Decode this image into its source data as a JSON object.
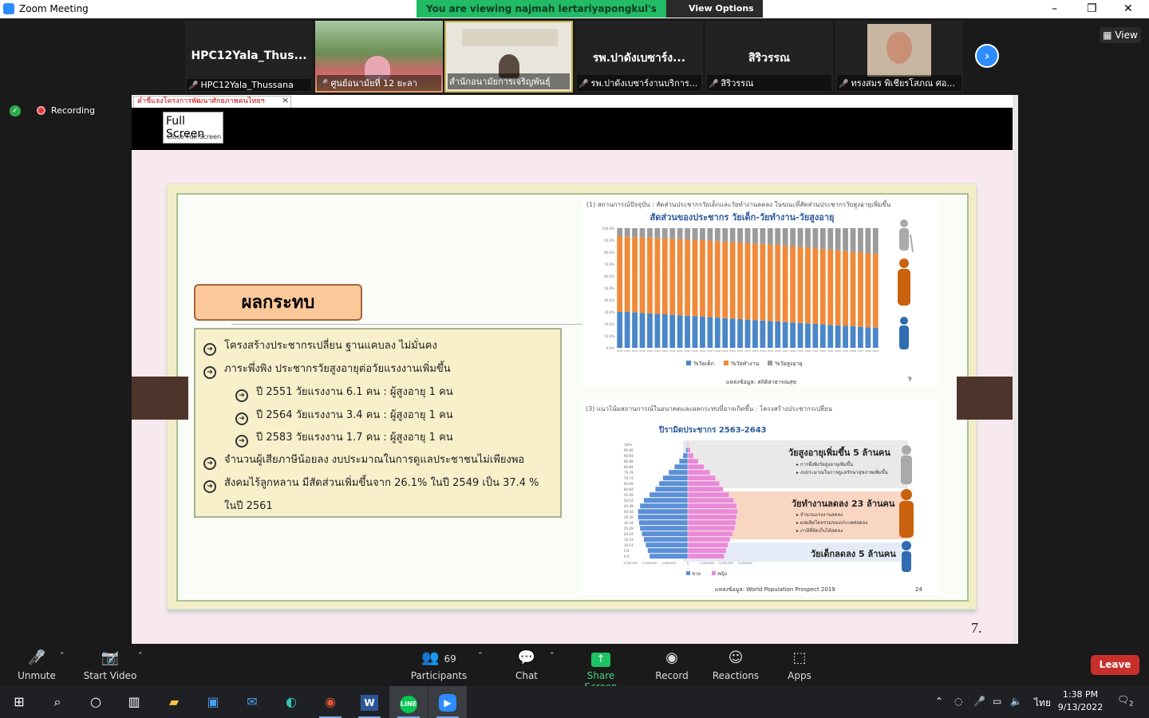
{
  "window": {
    "title": "Zoom Meeting",
    "minimize": "–",
    "restore": "❐",
    "close": "✕"
  },
  "banner": {
    "text": "You are viewing najmah lertariyapongkul's screen",
    "view_options": "View Options"
  },
  "participants_strip": [
    {
      "name": "HPC12Yala_Thus...",
      "label": "HPC12Yala_Thussana",
      "muted": true
    },
    {
      "name": "",
      "label": "ศูนย์อนามัยที่ 12 ยะลา",
      "muted": true
    },
    {
      "name": "",
      "label": "สำนักอนามัยการเจริญพันธุ์",
      "muted": false
    },
    {
      "name": "รพ.ปาดังเบซาร์ง...",
      "label": "รพ.ปาดังเบซาร์งานบริการ...",
      "muted": true
    },
    {
      "name": "สิริวรรณ",
      "label": "สิริวรรณ",
      "muted": true
    },
    {
      "name": "",
      "label": "ทรงสมร พิเชียรโสภณ ศอ...",
      "muted": true
    }
  ],
  "view_button": "View",
  "recording_label": "Recording",
  "browser_tab": {
    "title": "คำชี้แจงโครงการพัฒนาศักยภาพคนไทยฯ",
    "close": "×"
  },
  "fullscreen_tooltip": {
    "title": "Full Screen",
    "subtitle": "Close Full Screen"
  },
  "slide": {
    "heading": "ผลกระทบ",
    "bullets": [
      "โครงสร้างประชากรเปลี่ยน ฐานแคบลง ไม่มั่นคง",
      "ภาระพึ่งพิง ประชากรวัยสูงอายุต่อวัยแรงงานเพิ่มขึ้น",
      "ปี 2551 วัยแรงงาน 6.1 คน : ผู้สูงอายุ 1 คน",
      "ปี 2564 วัยแรงงาน 3.4 คน : ผู้สูงอายุ 1 คน",
      "ปี 2583 วัยแรงงาน 1.7 คน : ผู้สูงอายุ 1 คน",
      "จำนวนผู้เสียภาษีน้อยลง งบประมาณในการดูแลประชาชนไม่เพียงพอ",
      "สังคมไร้ลูกหลาน มีสัดส่วนเพิ่มขึ้นจาก 26.1% ในปี 2549 เป็น 37.4 %",
      "ในปี 2561"
    ],
    "page_number": "7.",
    "chart_caption": "(1) สถานการณ์ปัจจุบัน : สัดส่วนประชากรวัยเด็กและวัยทำงานลดลง ในขณะที่สัดส่วนประชากรวัยสูงอายุเพิ่มขึ้น",
    "chart_title": "สัดส่วนของประชากร วัยเด็ก-วัยทำงาน-วัยสูงอายุ",
    "chart_source": "แหล่งข้อมูล: สถิติสาธารณสุข",
    "chart_page": "9",
    "pyramid_caption": "(3) แนวโน้มสถานการณ์ในอนาคตและผลกระทบที่อาจเกิดขึ้น : โครงสร้างประชากรเปลี่ยน",
    "pyramid_title": "ปิรามิดประชากร 2563-2643",
    "pyramid_bands": [
      {
        "title": "วัยสูงอายุเพิ่มขึ้น 5 ล้านคน",
        "items": [
          "การพึ่งพิงวัยสูงอายุเพิ่มขึ้น",
          "งบประมาณในการดูแลรักษาสุขภาพเพิ่มขึ้น"
        ]
      },
      {
        "title": "วัยทำงานลดลง 23 ล้านคน",
        "items": [
          "จำนวนแรงงานลดลง",
          "ผลผลิตโดยรวมของประเทศลดลง",
          "ภาษีที่จัดเก็บได้ลดลง"
        ]
      },
      {
        "title": "วัยเด็กลดลง 5 ล้านคน",
        "items": []
      }
    ],
    "pyramid_legend": [
      "ชาย",
      "หญิง"
    ],
    "pyramid_source": "แหล่งข้อมูล: World Population Prospect 2019",
    "pyramid_page": "24"
  },
  "chart_data": [
    {
      "type": "bar",
      "title": "สัดส่วนของประชากร วัยเด็ก-วัยทำงาน-วัยสูงอายุ",
      "stacked": true,
      "categories": [
        "2535",
        "2536",
        "2537",
        "2538",
        "2539",
        "2540",
        "2541",
        "2542",
        "2543",
        "2544",
        "2545",
        "2546",
        "2547",
        "2548",
        "2549",
        "2550",
        "2551",
        "2552",
        "2553",
        "2554",
        "2555",
        "2556",
        "2557",
        "2558",
        "2559",
        "2560",
        "2561",
        "2562",
        "2563",
        "2564",
        "2565",
        "2566",
        "2567",
        "2568",
        "2569"
      ],
      "y_ticks": [
        "0.0%",
        "10.0%",
        "20.0%",
        "30.0%",
        "40.0%",
        "50.0%",
        "60.0%",
        "70.0%",
        "80.0%",
        "90.0%",
        "100.0%"
      ],
      "ylim": [
        0,
        100
      ],
      "series": [
        {
          "name": "%วัยเด็ก",
          "color": "#4a86c8",
          "values": [
            30,
            30,
            29.6,
            29.2,
            28.8,
            28.4,
            28,
            27.6,
            27.2,
            26.8,
            26.4,
            26,
            25.6,
            25.2,
            24.8,
            24.4,
            24,
            23.6,
            23.2,
            22.8,
            22.4,
            22,
            21.6,
            21.2,
            20.8,
            20.4,
            20,
            19.6,
            19.2,
            18.8,
            18.4,
            18,
            17.6,
            17.2,
            16.8
          ]
        },
        {
          "name": "%วัยทำงาน",
          "color": "#f08a3a",
          "values": [
            63,
            62.8,
            63,
            63.2,
            63.3,
            63.4,
            63.5,
            63.6,
            63.7,
            63.8,
            63.9,
            64,
            64,
            64,
            64,
            64,
            64,
            64,
            64,
            64,
            64,
            64,
            64,
            63.8,
            63.6,
            63.4,
            63.2,
            63,
            62.8,
            62.6,
            62.4,
            62.2,
            62,
            61.8,
            61.6
          ]
        },
        {
          "name": "%วัยสูงอายุ",
          "color": "#9b9b9b",
          "values": [
            7,
            7.2,
            7.4,
            7.6,
            7.9,
            8.2,
            8.5,
            8.8,
            9.1,
            9.4,
            9.7,
            10,
            10.4,
            10.8,
            11.2,
            11.6,
            12,
            12.4,
            12.8,
            13.2,
            13.6,
            14,
            14.4,
            15,
            15.6,
            16.2,
            16.8,
            17.4,
            18,
            18.6,
            19.2,
            19.8,
            20.4,
            21,
            21.6
          ]
        }
      ],
      "legend": "bottom"
    },
    {
      "type": "bar",
      "title": "ปิรามิดประชากร 2563-2643",
      "orientation": "horizontal",
      "categories": [
        "0-4",
        "5-9",
        "10-14",
        "15-19",
        "20-24",
        "25-29",
        "30-34",
        "35-39",
        "40-44",
        "45-49",
        "50-54",
        "55-59",
        "60-64",
        "65-69",
        "70-74",
        "75-79",
        "80-84",
        "85-89",
        "90-94",
        "95-99",
        "100+"
      ],
      "x_ticks": [
        "3,000,000",
        "2,000,000",
        "1,000,000",
        "0",
        "1,000,000",
        "2,000,000",
        "3,000,000"
      ],
      "series": [
        {
          "name": "ชาย",
          "color": "#5b8fd6",
          "values": [
            2000000,
            2100000,
            2200000,
            2300000,
            2400000,
            2500000,
            2550000,
            2600000,
            2600000,
            2500000,
            2300000,
            2000000,
            1700000,
            1500000,
            1300000,
            1000000,
            700000,
            450000,
            250000,
            100000,
            30000
          ]
        },
        {
          "name": "หญิง",
          "color": "#e98ad8",
          "values": [
            1900000,
            2000000,
            2100000,
            2200000,
            2350000,
            2450000,
            2500000,
            2550000,
            2600000,
            2550000,
            2400000,
            2150000,
            1850000,
            1650000,
            1450000,
            1150000,
            850000,
            550000,
            300000,
            130000,
            40000
          ]
        }
      ]
    }
  ],
  "toolbar": {
    "unmute": "Unmute",
    "start_video": "Start Video",
    "participants": "Participants",
    "participants_count": "69",
    "chat": "Chat",
    "share_screen": "Share Screen",
    "record": "Record",
    "reactions": "Reactions",
    "apps": "Apps",
    "leave": "Leave"
  },
  "taskbar": {
    "time": "1:38 PM",
    "date": "9/13/2022",
    "lang": "ไทย",
    "notif_count": "2"
  }
}
